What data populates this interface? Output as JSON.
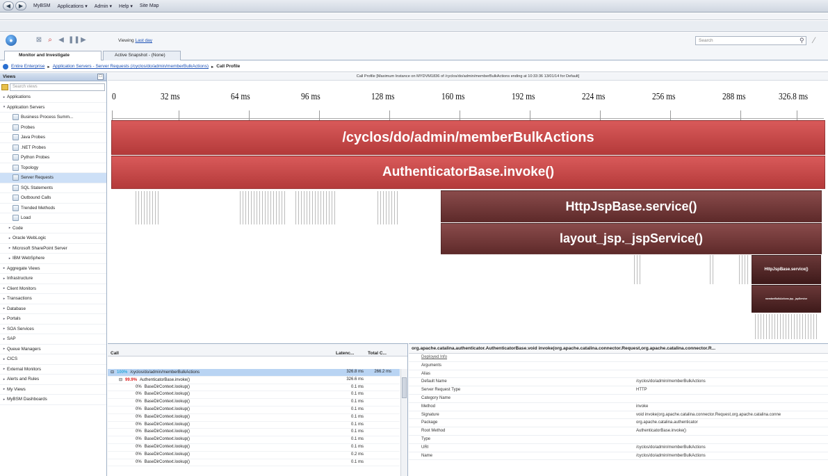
{
  "menu": {
    "items": [
      "MyBSM",
      "Applications ▾",
      "Admin ▾",
      "Help ▾",
      "Site Map"
    ]
  },
  "toolbar": {
    "viewing_prefix": "Viewing",
    "viewing_link": "Last day",
    "search_placeholder": "Search"
  },
  "tabs": {
    "monitor": "Monitor and Investigate",
    "snapshot": "Active Snapshot - (None)"
  },
  "breadcrumb": {
    "root": "Entire Enterprise",
    "sep": "▸",
    "middle": "Application Servers - Server Requests (/cyclos/do/admin/memberBulkActions)",
    "current": "Call Profile"
  },
  "views": {
    "title": "Views",
    "search_placeholder": "Search views",
    "items": [
      {
        "label": "Applications",
        "level": 0,
        "arrow": "▸"
      },
      {
        "label": "Application Servers",
        "level": 0,
        "arrow": "▾"
      },
      {
        "label": "Business Process Summ...",
        "level": 1,
        "arrow": ""
      },
      {
        "label": "Probes",
        "level": 1,
        "arrow": ""
      },
      {
        "label": "Java Probes",
        "level": 1,
        "arrow": ""
      },
      {
        "label": ".NET Probes",
        "level": 1,
        "arrow": ""
      },
      {
        "label": "Python Probes",
        "level": 1,
        "arrow": ""
      },
      {
        "label": "Topology",
        "level": 1,
        "arrow": ""
      },
      {
        "label": "Server Requests",
        "level": 1,
        "arrow": "",
        "selected": true
      },
      {
        "label": "SQL Statements",
        "level": 1,
        "arrow": ""
      },
      {
        "label": "Outbound Calls",
        "level": 1,
        "arrow": ""
      },
      {
        "label": "Trended Methods",
        "level": 1,
        "arrow": ""
      },
      {
        "label": "Load",
        "level": 1,
        "arrow": ""
      },
      {
        "label": "Code",
        "level": 1,
        "arrow": "▸",
        "noicon": true
      },
      {
        "label": "Oracle WebLogic",
        "level": 1,
        "arrow": "▸",
        "noicon": true
      },
      {
        "label": "Microsoft SharePoint Server",
        "level": 1,
        "arrow": "▸",
        "noicon": true
      },
      {
        "label": "IBM WebSphere",
        "level": 1,
        "arrow": "▸",
        "noicon": true
      },
      {
        "label": "Aggregate Views",
        "level": 0,
        "arrow": "▸"
      },
      {
        "label": "Infrastructure",
        "level": 0,
        "arrow": "▸"
      },
      {
        "label": "Client Monitors",
        "level": 0,
        "arrow": "▸"
      },
      {
        "label": "Transactions",
        "level": 0,
        "arrow": "▸"
      },
      {
        "label": "Database",
        "level": 0,
        "arrow": "▸"
      },
      {
        "label": "Portals",
        "level": 0,
        "arrow": "▸"
      },
      {
        "label": "SOA Services",
        "level": 0,
        "arrow": "▸"
      },
      {
        "label": "SAP",
        "level": 0,
        "arrow": "▸"
      },
      {
        "label": "Queue Managers",
        "level": 0,
        "arrow": "▸"
      },
      {
        "label": "CICS",
        "level": 0,
        "arrow": "▸"
      },
      {
        "label": "External Monitors",
        "level": 0,
        "arrow": "▸"
      },
      {
        "label": "Alerts and Rules",
        "level": 0,
        "arrow": "▸"
      },
      {
        "label": "My Views",
        "level": 0,
        "arrow": "▸"
      },
      {
        "label": "MyBSM Dashboards",
        "level": 0,
        "arrow": "▸"
      }
    ]
  },
  "profile": {
    "title": "Call Profile [Maximum Instance on MYDVM1836 of /cyclos/do/admin/memberBulkActions ending at 10:33:36 13/01/14 for Default]",
    "ticks": [
      "0",
      "32 ms",
      "64 ms",
      "96 ms",
      "128 ms",
      "160 ms",
      "192 ms",
      "224 ms",
      "256 ms",
      "288 ms",
      "326.8 ms"
    ],
    "bars": [
      {
        "label": "/cyclos/do/admin/memberBulkActions",
        "style": "red"
      },
      {
        "label": "AuthenticatorBase.invoke()",
        "style": "red"
      },
      {
        "label": "HttpJspBase.service()",
        "style": "dark"
      },
      {
        "label": "layout_jsp._jspService()",
        "style": "dark"
      },
      {
        "label": "HttpJspBase.service()",
        "style": "small"
      },
      {
        "label": "memberBulkActions.jsp._jspService",
        "style": "small"
      }
    ]
  },
  "calltable": {
    "col_call": "Call",
    "col_latency": "Latenc...",
    "col_total": "Total C...",
    "rows": [
      {
        "pct": "100%",
        "pct_style": "hl",
        "name": "/cyclos/do/admin/memberBulkActions",
        "latency": "326.8 ms",
        "total": "266.2 ms",
        "indent": 0,
        "selected": true,
        "toggle": "⊟"
      },
      {
        "pct": "99.9%",
        "pct_style": "red",
        "name": "AuthenticatorBase.invoke()",
        "latency": "326.6 ms",
        "total": "",
        "indent": 1,
        "toggle": "⊟"
      },
      {
        "pct": "0%",
        "name": "BaseDirContext.lookup()",
        "latency": "0.1 ms",
        "total": "",
        "indent": 2
      },
      {
        "pct": "0%",
        "name": "BaseDirContext.lookup()",
        "latency": "0.1 ms",
        "total": "",
        "indent": 2
      },
      {
        "pct": "0%",
        "name": "BaseDirContext.lookup()",
        "latency": "0.1 ms",
        "total": "",
        "indent": 2
      },
      {
        "pct": "0%",
        "name": "BaseDirContext.lookup()",
        "latency": "0.1 ms",
        "total": "",
        "indent": 2
      },
      {
        "pct": "0%",
        "name": "BaseDirContext.lookup()",
        "latency": "0.1 ms",
        "total": "",
        "indent": 2
      },
      {
        "pct": "0%",
        "name": "BaseDirContext.lookup()",
        "latency": "0.1 ms",
        "total": "",
        "indent": 2
      },
      {
        "pct": "0%",
        "name": "BaseDirContext.lookup()",
        "latency": "0.1 ms",
        "total": "",
        "indent": 2
      },
      {
        "pct": "0%",
        "name": "BaseDirContext.lookup()",
        "latency": "0.1 ms",
        "total": "",
        "indent": 2
      },
      {
        "pct": "0%",
        "name": "BaseDirContext.lookup()",
        "latency": "0.1 ms",
        "total": "",
        "indent": 2
      },
      {
        "pct": "0%",
        "name": "BaseDirContext.lookup()",
        "latency": "0.2 ms",
        "total": "",
        "indent": 2
      },
      {
        "pct": "0%",
        "name": "BaseDirContext.lookup()",
        "latency": "0.1 ms",
        "total": "",
        "indent": 2
      }
    ]
  },
  "details": {
    "header": "org.apache.catalina.authenticator.AuthenticatorBase.void invoke(org.apache.catalina.connector.Request,org.apache.catalina.connector.R...",
    "rows": [
      {
        "k": "Deployed Info",
        "v": ""
      },
      {
        "k": "Arguments",
        "v": ""
      },
      {
        "k": "Alias",
        "v": ""
      },
      {
        "k": "Default Name",
        "v": "/cyclos/do/admin/memberBulkActions"
      },
      {
        "k": "Server Request Type",
        "v": "HTTP"
      },
      {
        "k": "Category Name",
        "v": ""
      },
      {
        "k": "Method",
        "v": "invoke"
      },
      {
        "k": "Signature",
        "v": "void invoke(org.apache.catalina.connector.Request,org.apache.catalina.conne"
      },
      {
        "k": "Package",
        "v": "org.apache.catalina.authenticator"
      },
      {
        "k": "Root Method",
        "v": "AuthenticatorBase.invoke()"
      },
      {
        "k": "Type",
        "v": ""
      },
      {
        "k": "URI",
        "v": "/cyclos/do/admin/memberBulkActions"
      },
      {
        "k": "Name",
        "v": "/cyclos/do/admin/memberBulkActions"
      }
    ]
  }
}
